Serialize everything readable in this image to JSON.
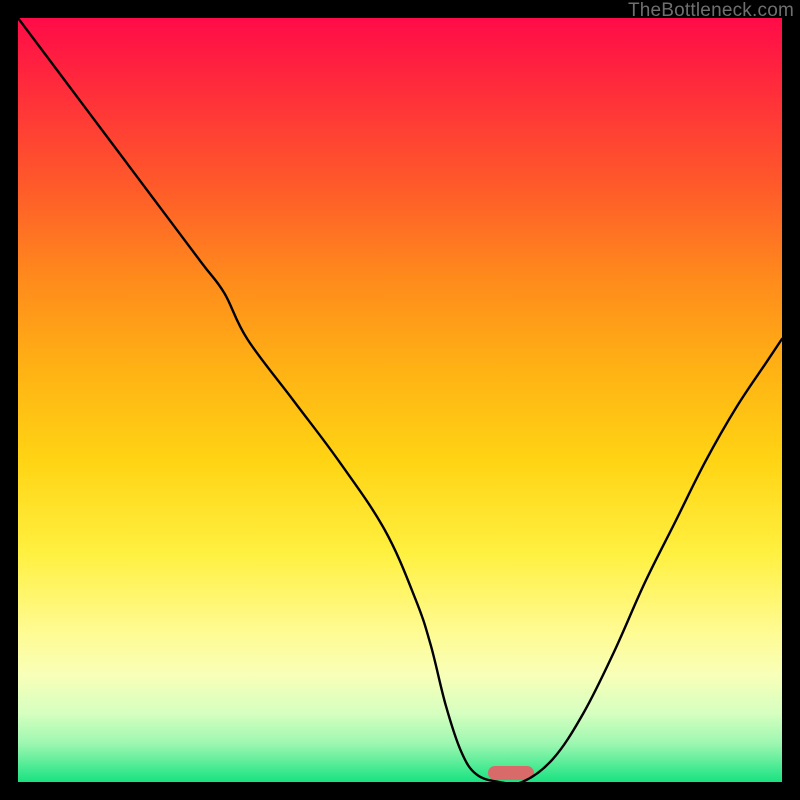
{
  "watermark": "TheBottleneck.com",
  "colors": {
    "frame": "#000000",
    "marker": "#d96a6a",
    "curve": "#000000"
  },
  "chart_data": {
    "type": "line",
    "title": "",
    "xlabel": "",
    "ylabel": "",
    "xlim": [
      0,
      100
    ],
    "ylim": [
      0,
      100
    ],
    "x": [
      0,
      6,
      12,
      18,
      24,
      27,
      30,
      36,
      42,
      48,
      52,
      54,
      56,
      58,
      60,
      63,
      66,
      70,
      74,
      78,
      82,
      86,
      90,
      94,
      98,
      100
    ],
    "y": [
      100,
      92,
      84,
      76,
      68,
      64,
      58,
      50,
      42,
      33,
      24,
      18,
      10,
      4,
      1,
      0,
      0,
      3,
      9,
      17,
      26,
      34,
      42,
      49,
      55,
      58
    ],
    "marker": {
      "x_center": 64.5,
      "width_pct": 6.0
    },
    "note": "y is bottleneck percentage; 0 = ideal (green), 100 = worst (red). x is a normalized component-balance axis without visible tick labels."
  }
}
